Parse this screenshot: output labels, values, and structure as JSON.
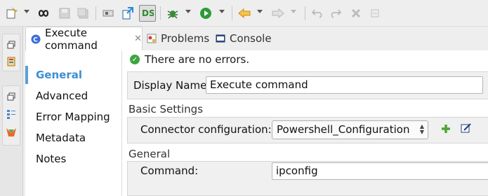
{
  "toolbar": {
    "icons": [
      "new-icon",
      "dropdown",
      "infinity-icon",
      "save-icon",
      "save-all-icon",
      "ref-icon",
      "deploy-icon",
      "ds-perspective-icon",
      "debug-icon",
      "run-icon",
      "back-icon",
      "forward-icon",
      "undo-icon",
      "redo-icon",
      "stop-icon",
      "minimize-icon"
    ]
  },
  "tabs": [
    {
      "label": "Execute command",
      "active": true
    },
    {
      "label": "Problems",
      "active": false
    },
    {
      "label": "Console",
      "active": false
    }
  ],
  "nav": {
    "items": [
      "General",
      "Advanced",
      "Error Mapping",
      "Metadata",
      "Notes"
    ],
    "selected": "General"
  },
  "status": {
    "text": "There are no errors."
  },
  "display_name": {
    "label": "Display Name:",
    "value": "Execute command"
  },
  "basic_settings": {
    "title": "Basic Settings",
    "connector_label": "Connector configuration:",
    "connector_value": "Powershell_Configuration"
  },
  "general": {
    "title": "General",
    "command_label": "Command:",
    "command_value": "ipconfig"
  },
  "colors": {
    "accent": "#3d8fd1",
    "ok_green": "#3ea43e",
    "run_green": "#2e9a3a",
    "back_orange": "#e8a33a"
  }
}
